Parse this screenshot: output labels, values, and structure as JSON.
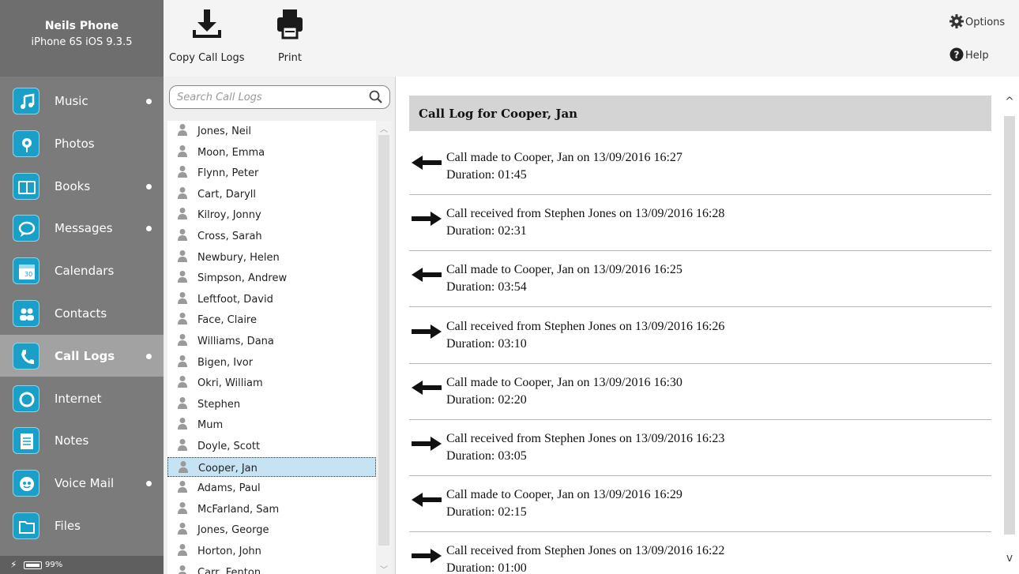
{
  "device": {
    "name": "Neils Phone",
    "model": "iPhone 6S iOS 9.3.5"
  },
  "nav": [
    {
      "label": "Music",
      "icon": "music-note-icon",
      "dot": true,
      "selected": false
    },
    {
      "label": "Photos",
      "icon": "flower-icon",
      "dot": false,
      "selected": false
    },
    {
      "label": "Books",
      "icon": "book-icon",
      "dot": true,
      "selected": false
    },
    {
      "label": "Messages",
      "icon": "speech-bubble-icon",
      "dot": true,
      "selected": false
    },
    {
      "label": "Calendars",
      "icon": "calendar-icon",
      "dot": false,
      "selected": false
    },
    {
      "label": "Contacts",
      "icon": "people-icon",
      "dot": false,
      "selected": false
    },
    {
      "label": "Call Logs",
      "icon": "phone-handset-icon",
      "dot": true,
      "selected": true
    },
    {
      "label": "Internet",
      "icon": "globe-ring-icon",
      "dot": false,
      "selected": false
    },
    {
      "label": "Notes",
      "icon": "notepad-icon",
      "dot": false,
      "selected": false
    },
    {
      "label": "Voice Mail",
      "icon": "voicemail-icon",
      "dot": true,
      "selected": false
    },
    {
      "label": "Files",
      "icon": "folder-icon",
      "dot": false,
      "selected": false
    }
  ],
  "battery": {
    "percent": "99%"
  },
  "toolbar": {
    "copy_label": "Copy Call Logs",
    "print_label": "Print",
    "options_label": "Options",
    "help_label": "Help"
  },
  "search": {
    "placeholder": "Search Call Logs",
    "value": ""
  },
  "contacts": [
    "Jones, Neil",
    "Moon, Emma",
    "Flynn, Peter",
    "Cart, Daryll",
    "Kilroy, Jonny",
    "Cross, Sarah",
    "Newbury, Helen",
    "Simpson, Andrew",
    "Leftfoot, David",
    "Face, Claire",
    "Williams, Dana",
    "Bigen, Ivor",
    "Okri, William",
    "Stephen",
    "Mum",
    "Doyle, Scott",
    "Cooper, Jan",
    "Adams, Paul",
    "McFarland, Sam",
    "Jones, George",
    "Horton, John",
    "Carr, Fenton"
  ],
  "selected_contact": "Cooper, Jan",
  "detail": {
    "title": "Call Log for Cooper, Jan",
    "entries": [
      {
        "direction": "outgoing",
        "text": "Call made to Cooper, Jan on 13/09/2016 16:27",
        "duration": "Duration: 01:45"
      },
      {
        "direction": "incoming",
        "text": "Call received from Stephen Jones on 13/09/2016 16:28",
        "duration": "Duration: 02:31"
      },
      {
        "direction": "outgoing",
        "text": "Call made to Cooper, Jan on 13/09/2016 16:25",
        "duration": "Duration: 03:54"
      },
      {
        "direction": "incoming",
        "text": "Call received from Stephen Jones on 13/09/2016 16:26",
        "duration": "Duration: 03:10"
      },
      {
        "direction": "outgoing",
        "text": "Call made to Cooper, Jan on 13/09/2016 16:30",
        "duration": "Duration: 02:20"
      },
      {
        "direction": "incoming",
        "text": "Call received from Stephen Jones on 13/09/2016 16:23",
        "duration": "Duration: 03:05"
      },
      {
        "direction": "outgoing",
        "text": "Call made to Cooper, Jan on 13/09/2016 16:29",
        "duration": "Duration: 02:15"
      },
      {
        "direction": "incoming",
        "text": "Call received from Stephen Jones on 13/09/2016 16:22",
        "duration": "Duration: 01:00"
      }
    ]
  },
  "colors": {
    "sidebar": "#7b7b7b",
    "accent_icon": "#1aa0c8",
    "selection": "#c6e3f4",
    "header": "#d4d4d4"
  }
}
